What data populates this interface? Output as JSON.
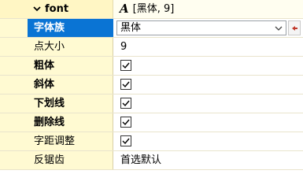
{
  "group": {
    "label": "font",
    "value": "[黑体, 9]",
    "icon": "font-glyph-icon",
    "icon_glyph": "A"
  },
  "rows": [
    {
      "label": "字体族",
      "value": "黑体",
      "type": "combo",
      "selected": true
    },
    {
      "label": "点大小",
      "value": "9",
      "type": "text"
    },
    {
      "label": "粗体",
      "checked": true,
      "type": "check"
    },
    {
      "label": "斜体",
      "checked": true,
      "type": "check"
    },
    {
      "label": "下划线",
      "checked": true,
      "type": "check"
    },
    {
      "label": "删除线",
      "checked": true,
      "type": "check"
    },
    {
      "label": "字距调整",
      "checked": true,
      "type": "check"
    },
    {
      "label": "反锯齿",
      "value": "首选默认",
      "type": "text"
    }
  ],
  "colors": {
    "name_bg": "#fffad2",
    "selected_bg": "#0a74d4",
    "reset_arrow": "#c0392b"
  }
}
